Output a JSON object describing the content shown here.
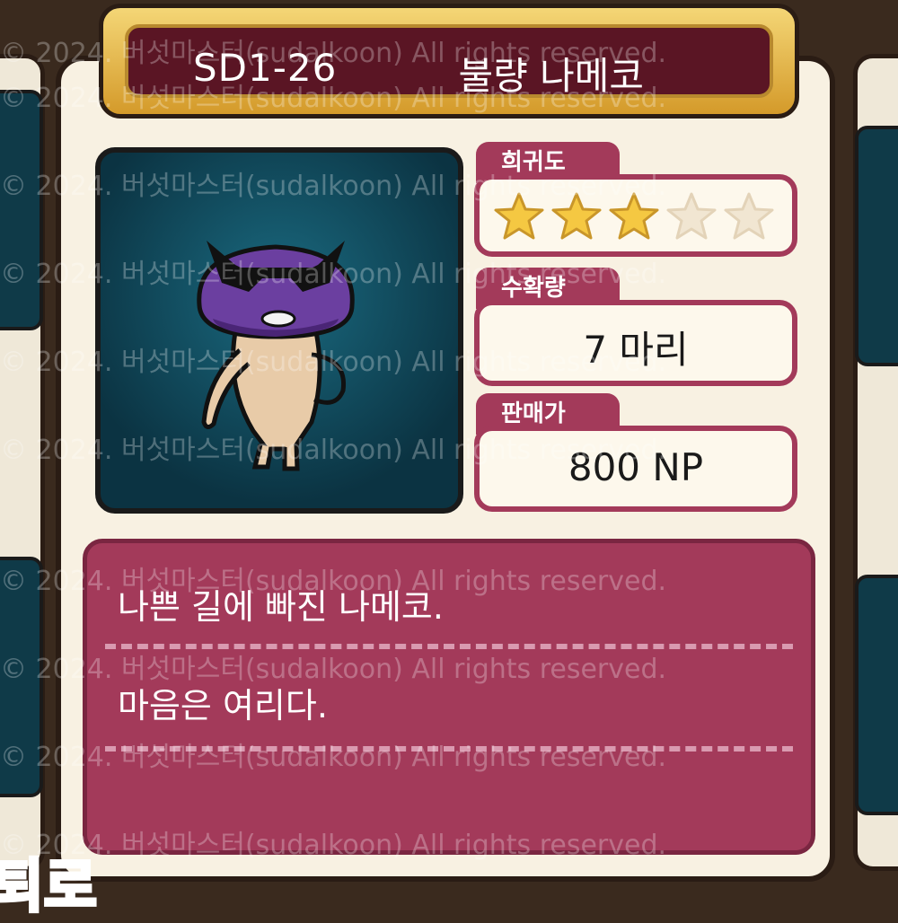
{
  "item": {
    "code": "SD1-26",
    "name": "불량 나메코"
  },
  "rarity": {
    "label": "희귀도",
    "stars_filled": 3,
    "stars_total": 5
  },
  "harvest": {
    "label": "수확량",
    "value": "7 마리"
  },
  "price": {
    "label": "판매가",
    "value": "800 NP"
  },
  "description": {
    "line1": "나쁜 길에 빠진 나메코.",
    "line2": "마음은 여리다."
  },
  "watermark": "© 2024. 버섯마스터(sudalkoon) All rights reserved.",
  "corner_text": "퇴로",
  "colors": {
    "accent": "#a33a5a",
    "title_bg": "#5a1524",
    "gold": "#e6b84a",
    "portrait_bg": "#0f4a5e"
  }
}
